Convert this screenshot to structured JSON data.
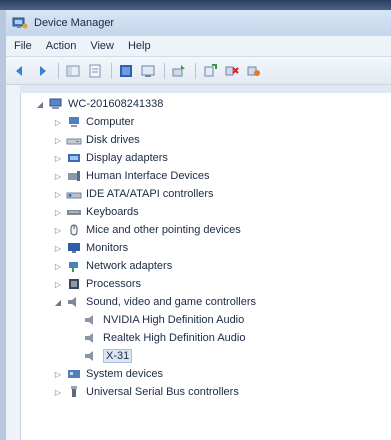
{
  "window": {
    "title": "Device Manager"
  },
  "menu": [
    {
      "label": "File"
    },
    {
      "label": "Action"
    },
    {
      "label": "View"
    },
    {
      "label": "Help"
    }
  ],
  "toolbar": {
    "icons": [
      "back-icon",
      "forward-icon",
      "show-hide-icon",
      "properties-icon",
      "help-icon",
      "scan-icon",
      "update-driver-icon",
      "uninstall-icon",
      "disable-icon"
    ]
  },
  "tree": {
    "root": "WC-201608241338",
    "items": [
      {
        "label": "Computer",
        "icon": "computer-icon",
        "expanded": false
      },
      {
        "label": "Disk drives",
        "icon": "disk-drive-icon",
        "expanded": false
      },
      {
        "label": "Display adapters",
        "icon": "display-adapter-icon",
        "expanded": false
      },
      {
        "label": "Human Interface Devices",
        "icon": "hid-icon",
        "expanded": false
      },
      {
        "label": "IDE ATA/ATAPI controllers",
        "icon": "ide-controller-icon",
        "expanded": false
      },
      {
        "label": "Keyboards",
        "icon": "keyboard-icon",
        "expanded": false
      },
      {
        "label": "Mice and other pointing devices",
        "icon": "mouse-icon",
        "expanded": false
      },
      {
        "label": "Monitors",
        "icon": "monitor-icon",
        "expanded": false
      },
      {
        "label": "Network adapters",
        "icon": "network-adapter-icon",
        "expanded": false
      },
      {
        "label": "Processors",
        "icon": "processor-icon",
        "expanded": false
      },
      {
        "label": "Sound, video and game controllers",
        "icon": "sound-icon",
        "expanded": true,
        "children": [
          {
            "label": "NVIDIA High Definition Audio",
            "icon": "audio-device-icon"
          },
          {
            "label": "Realtek High Definition Audio",
            "icon": "audio-device-icon"
          },
          {
            "label": "X-31",
            "icon": "audio-device-icon",
            "selected": true
          }
        ]
      },
      {
        "label": "System devices",
        "icon": "system-devices-icon",
        "expanded": false
      },
      {
        "label": "Universal Serial Bus controllers",
        "icon": "usb-icon",
        "expanded": false
      }
    ]
  },
  "colors": {
    "accent": "#2e6bc4",
    "selection": "#dbe6f5",
    "title_bg": "#c4d6ec"
  }
}
